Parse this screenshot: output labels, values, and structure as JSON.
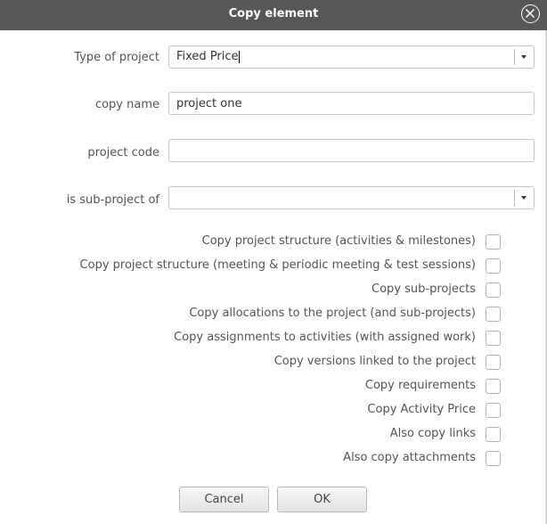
{
  "dialog": {
    "title": "Copy element",
    "close_icon": "close-circle-icon"
  },
  "form": {
    "type_of_project": {
      "label": "Type of project",
      "value": "Fixed Price",
      "arrow_icon": "chevron-down-icon"
    },
    "copy_name": {
      "label": "copy name",
      "value": "project one"
    },
    "project_code": {
      "label": "project code",
      "value": ""
    },
    "sub_project_of": {
      "label": "is sub-project of",
      "value": "",
      "arrow_icon": "chevron-down-icon"
    }
  },
  "options": [
    {
      "label": "Copy project structure (activities & milestones)",
      "checked": false
    },
    {
      "label": "Copy project structure (meeting & periodic meeting & test sessions)",
      "checked": false
    },
    {
      "label": "Copy sub-projects",
      "checked": false
    },
    {
      "label": "Copy allocations to the project (and sub-projects)",
      "checked": false
    },
    {
      "label": "Copy assignments to activities (with assigned work)",
      "checked": false
    },
    {
      "label": "Copy versions linked to the project",
      "checked": false
    },
    {
      "label": "Copy requirements",
      "checked": false
    },
    {
      "label": "Copy Activity Price",
      "checked": false
    },
    {
      "label": "Also copy links",
      "checked": false
    },
    {
      "label": "Also copy attachments",
      "checked": false
    }
  ],
  "buttons": {
    "cancel": "Cancel",
    "ok": "OK"
  },
  "colors": {
    "titlebar": "#575757",
    "text": "#555555"
  }
}
